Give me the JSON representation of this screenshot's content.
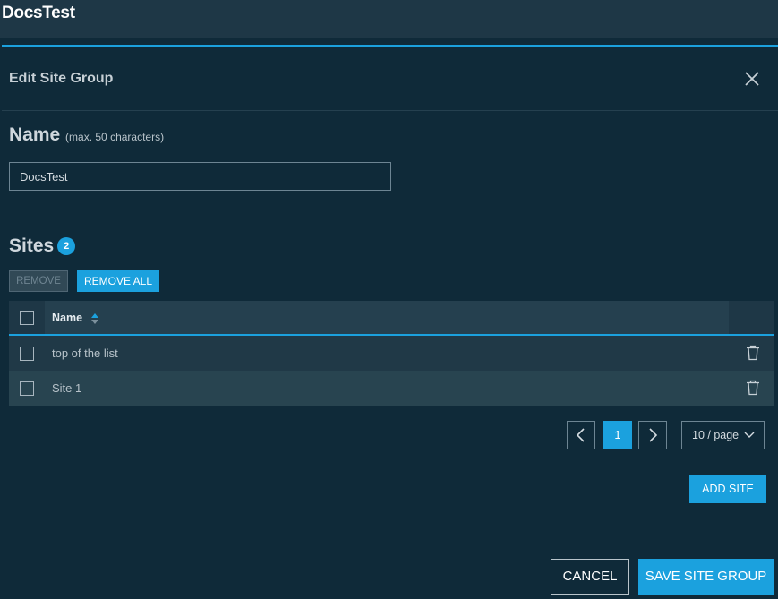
{
  "app": {
    "title": "DocsTest"
  },
  "modal": {
    "title": "Edit Site Group",
    "name_section": {
      "label": "Name",
      "hint": "(max. 50 characters)",
      "value": "DocsTest"
    },
    "sites_section": {
      "label": "Sites",
      "count": "2",
      "remove_label": "REMOVE",
      "remove_all_label": "REMOVE ALL",
      "table": {
        "columns": [
          "Name"
        ],
        "rows": [
          {
            "name": "top of the list"
          },
          {
            "name": "Site 1"
          }
        ]
      }
    },
    "pagination": {
      "current_page": "1",
      "page_size": "10 / page"
    },
    "add_site_label": "ADD SITE",
    "cancel_label": "CANCEL",
    "save_label": "SAVE SITE GROUP"
  },
  "colors": {
    "accent": "#1ba1de",
    "background": "#0f2a39",
    "topbar": "#1e3746"
  }
}
